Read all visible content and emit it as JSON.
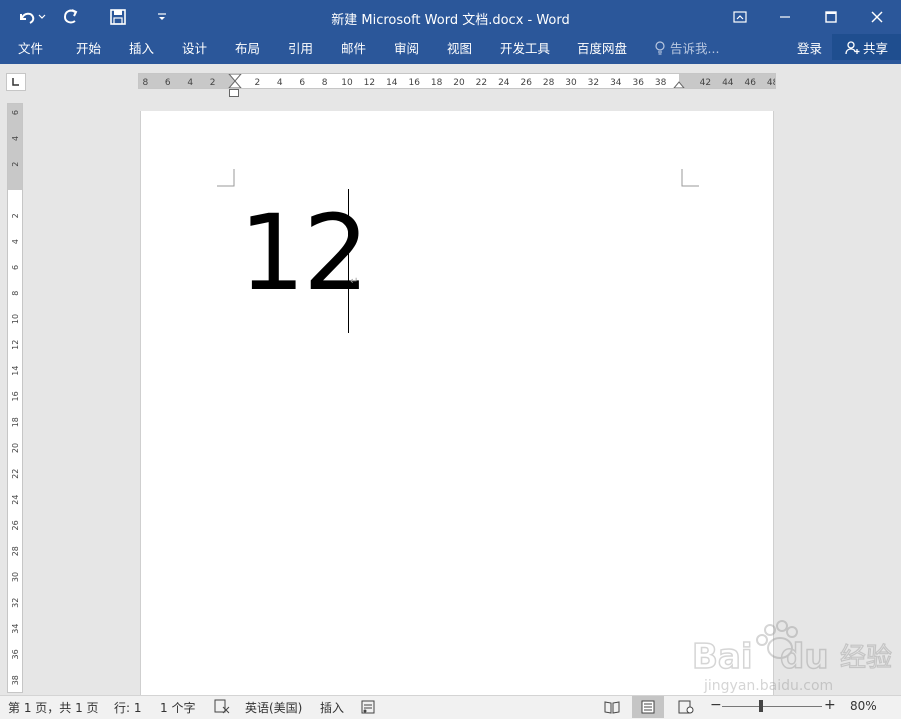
{
  "title": "新建 Microsoft Word 文档.docx - Word",
  "quick_access": {
    "undo": "undo-icon",
    "redo": "redo-icon",
    "save": "save-icon",
    "customize": "customize-icon"
  },
  "ribbon": {
    "tabs": [
      "文件",
      "开始",
      "插入",
      "设计",
      "布局",
      "引用",
      "邮件",
      "审阅",
      "视图",
      "开发工具",
      "百度网盘"
    ],
    "tell_me": "告诉我...",
    "login": "登录",
    "share": "共享"
  },
  "ruler": {
    "horizontal_left": [
      "8",
      "6",
      "4",
      "2"
    ],
    "horizontal_right": [
      "2",
      "4",
      "6",
      "8",
      "10",
      "12",
      "14",
      "16",
      "18",
      "20",
      "22",
      "24",
      "26",
      "28",
      "30",
      "32",
      "34",
      "36",
      "38",
      "42",
      "44",
      "46",
      "48"
    ],
    "vertical_top": [
      "6",
      "4",
      "2"
    ],
    "vertical": [
      "2",
      "4",
      "6",
      "8",
      "10",
      "12",
      "14",
      "16",
      "18",
      "20",
      "22",
      "24",
      "26",
      "28",
      "30",
      "32",
      "34",
      "36",
      "38"
    ]
  },
  "document": {
    "text": "12"
  },
  "status": {
    "page": "第 1 页，共 1 页",
    "line": "行: 1",
    "words": "1 个字",
    "language": "英语(美国)",
    "mode": "插入",
    "zoom": "80%",
    "zoom_percent": 80
  },
  "colors": {
    "accent": "#2b579a",
    "page": "#ffffff",
    "background": "#e6e6e6"
  },
  "watermark": {
    "brand": "Baidu",
    "brand_suffix": "经验",
    "url": "jingyan.baidu.com"
  }
}
